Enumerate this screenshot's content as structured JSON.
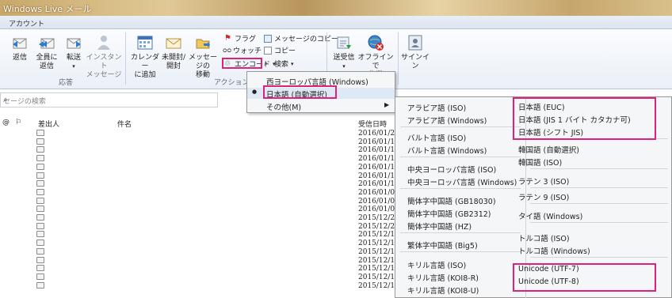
{
  "window": {
    "title": "Windows Live メール"
  },
  "tabs": {
    "account": "アカウント"
  },
  "ribbon": {
    "reply": "返信",
    "reply_all_l1": "全員に",
    "reply_all_l2": "返信",
    "forward": "転送",
    "instant_l1": "インスタント",
    "instant_l2": "メッセージ",
    "calendar_l1": "カレンダー",
    "calendar_l2": "に追加",
    "unread_l1": "未開封/",
    "unread_l2": "開封",
    "move_l1": "メッセージの",
    "move_l2": "移動",
    "flag": "フラグ",
    "watch": "ウォッチ",
    "encode": "エンコード",
    "copy_message": "メッセージのコピー",
    "copy": "コピー",
    "search": "検索",
    "send_receive_l1": "送受信",
    "offline_l1": "オフラインで",
    "offline_l2": "作業",
    "signin": "サインイン",
    "group_response": "応答",
    "group_action": "アクション"
  },
  "search": {
    "placeholder": "セージの検索"
  },
  "columns": {
    "sender": "差出人",
    "subject": "件名",
    "received": "受信日時"
  },
  "messages": [
    {
      "date": "2016/01/2"
    },
    {
      "date": "2016/01/1"
    },
    {
      "date": "2016/01/1"
    },
    {
      "date": "2016/01/1"
    },
    {
      "date": "2016/01/1"
    },
    {
      "date": "2016/01/1"
    },
    {
      "date": "2016/01/1"
    },
    {
      "date": "2016/01/0"
    },
    {
      "date": "2016/01/0"
    },
    {
      "date": "2016/01/0"
    },
    {
      "date": "2015/12/2"
    },
    {
      "date": "2015/12/2"
    },
    {
      "date": "2015/12/1"
    },
    {
      "date": "2015/12/1"
    },
    {
      "date": "2015/12/1"
    },
    {
      "date": "2015/12/1"
    },
    {
      "date": "2015/12/1"
    },
    {
      "date": "2015/12/1"
    },
    {
      "date": "2015/12/1"
    }
  ],
  "encode_menu": {
    "western": "西ヨーロッパ言語 (Windows)",
    "japanese_auto": "日本語 (自動選択)",
    "other": "その他(M)"
  },
  "submenu": {
    "col1": [
      "アラビア語 (ISO)",
      "アラビア語 (Windows)",
      "バルト言語 (ISO)",
      "バルト言語 (Windows)",
      "中央ヨーロッパ言語 (ISO)",
      "中央ヨーロッパ言語 (Windows)",
      "簡体字中国語 (GB18030)",
      "簡体字中国語 (GB2312)",
      "簡体字中国語 (HZ)",
      "繁体字中国語 (Big5)",
      "キリル言語 (ISO)",
      "キリル言語 (KOI8-R)",
      "キリル言語 (KOI8-U)"
    ],
    "col2": [
      "日本語 (EUC)",
      "日本語 (JIS 1 バイト カタカナ可)",
      "日本語 (シフト JIS)",
      "韓国語 (自動選択)",
      "韓国語 (ISO)",
      "ラテン 3 (ISO)",
      "ラテン 9 (ISO)",
      "タイ語 (Windows)",
      "トルコ語 (ISO)",
      "トルコ語 (Windows)",
      "Unicode (UTF-7)",
      "Unicode (UTF-8)"
    ]
  },
  "colors": {
    "highlight": "#e0217a",
    "selected_bg": "#dfe9f6"
  }
}
